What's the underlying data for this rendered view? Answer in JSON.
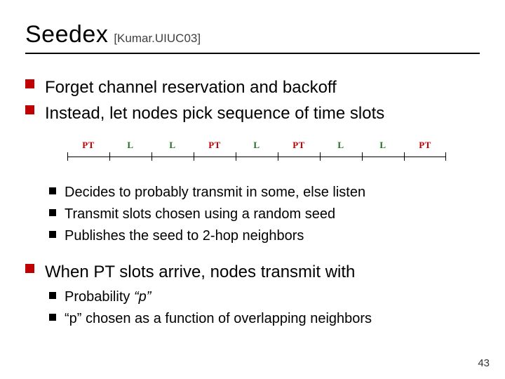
{
  "title": "Seedex",
  "citation": "[Kumar.UIUC03]",
  "bullets_top": [
    "Forget channel reservation and backoff",
    "Instead, let nodes pick sequence of time slots"
  ],
  "timeline": {
    "labels": [
      "PT",
      "L",
      "L",
      "PT",
      "L",
      "PT",
      "L",
      "L",
      "PT"
    ]
  },
  "sub_a": [
    "Decides to probably transmit in some, else listen",
    "Transmit slots chosen using a random seed",
    "Publishes the seed to 2-hop neighbors"
  ],
  "bullet_mid": "When PT slots arrive, nodes transmit with",
  "sub_b": [
    "Probability “p”",
    "“p” chosen as a function of overlapping neighbors"
  ],
  "page_number": "43"
}
